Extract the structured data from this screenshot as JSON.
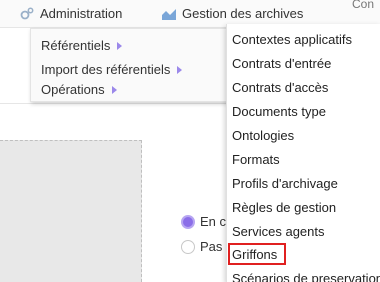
{
  "topbar": {
    "admin_label": "Administration",
    "admin_icon": "gears-icon",
    "archives_label": "Gestion des archives",
    "archives_icon": "chart-icon",
    "right_label": "Con"
  },
  "submenu": {
    "items": [
      {
        "label": "Référentiels"
      },
      {
        "label": "Import des référentiels"
      },
      {
        "label": "Opérations"
      }
    ]
  },
  "flyout": {
    "items": [
      {
        "label": "Contextes applicatifs"
      },
      {
        "label": "Contrats d'entrée"
      },
      {
        "label": "Contrats d'accès"
      },
      {
        "label": "Documents type"
      },
      {
        "label": "Ontologies"
      },
      {
        "label": "Formats"
      },
      {
        "label": "Profils d'archivage"
      },
      {
        "label": "Règles de gestion"
      },
      {
        "label": "Services agents"
      },
      {
        "label": "Griffons"
      },
      {
        "label": "Scénarios de preservation"
      }
    ],
    "highlighted_item": "Griffons",
    "highlight_color": "#e02020"
  },
  "radios": [
    {
      "label": "En co",
      "selected": true
    },
    {
      "label": "Pas a",
      "selected": false
    }
  ],
  "colors": {
    "accent": "#8b6ee8",
    "caret": "#9b88ea"
  }
}
